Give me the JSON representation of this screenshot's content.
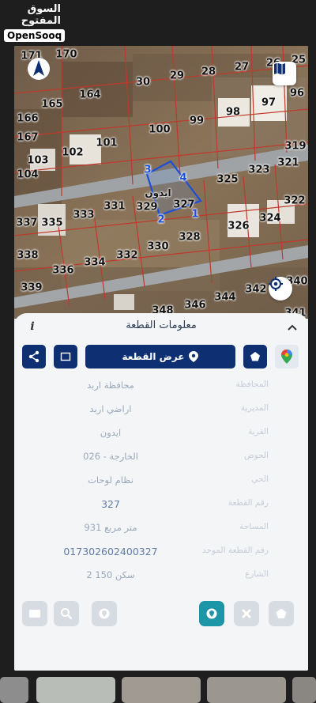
{
  "watermark": {
    "arabic": "السوق المفتوح",
    "english": "OpenSooq"
  },
  "map": {
    "parcels": [
      {
        "n": "171"
      },
      {
        "n": "170"
      },
      {
        "n": "27"
      },
      {
        "n": "26"
      },
      {
        "n": "25"
      },
      {
        "n": "30"
      },
      {
        "n": "29"
      },
      {
        "n": "28"
      },
      {
        "n": "164"
      },
      {
        "n": "165"
      },
      {
        "n": "97"
      },
      {
        "n": "96"
      },
      {
        "n": "98"
      },
      {
        "n": "166"
      },
      {
        "n": "100"
      },
      {
        "n": "99"
      },
      {
        "n": "167"
      },
      {
        "n": "101"
      },
      {
        "n": "102"
      },
      {
        "n": "319"
      },
      {
        "n": "103"
      },
      {
        "n": "104"
      },
      {
        "n": "325"
      },
      {
        "n": "323"
      },
      {
        "n": "321"
      },
      {
        "n": "322"
      },
      {
        "n": "333"
      },
      {
        "n": "331"
      },
      {
        "n": "329"
      },
      {
        "n": "327"
      },
      {
        "n": "324"
      },
      {
        "n": "337"
      },
      {
        "n": "335"
      },
      {
        "n": "326"
      },
      {
        "n": "328"
      },
      {
        "n": "338"
      },
      {
        "n": "334"
      },
      {
        "n": "332"
      },
      {
        "n": "330"
      },
      {
        "n": "336"
      },
      {
        "n": "339"
      },
      {
        "n": "342"
      },
      {
        "n": "340"
      },
      {
        "n": "344"
      },
      {
        "n": "348"
      },
      {
        "n": "346"
      },
      {
        "n": "341"
      }
    ],
    "selected_corners": [
      "1",
      "2",
      "3",
      "4"
    ],
    "area_label": "ايدون"
  },
  "panel": {
    "title": "معلومات القطعة",
    "info_icon": "i",
    "show_parcel_label": "عرض القطعة",
    "rows": [
      {
        "label": "المحافظة",
        "value": "محافظة اربد"
      },
      {
        "label": "المديرية",
        "value": "اراضي اربد"
      },
      {
        "label": "القرية",
        "value": "ايدون"
      },
      {
        "label": "الحوض",
        "value": "الخارجة - 026"
      },
      {
        "label": "الحي",
        "value": "نظام لوحات"
      },
      {
        "label": "رقم القطعة",
        "value": "327"
      },
      {
        "label": "المساحة",
        "value": "931 متر مربع"
      },
      {
        "label": "رقم القطعة الموحد",
        "value": "017302602400327"
      },
      {
        "label": "الشارع",
        "value": "2 سكن 150"
      }
    ]
  },
  "colors": {
    "navy": "#0f2f73",
    "teal": "#1c95a6",
    "parcel_line": "#c0392b",
    "selection": "#1d4fd6"
  }
}
